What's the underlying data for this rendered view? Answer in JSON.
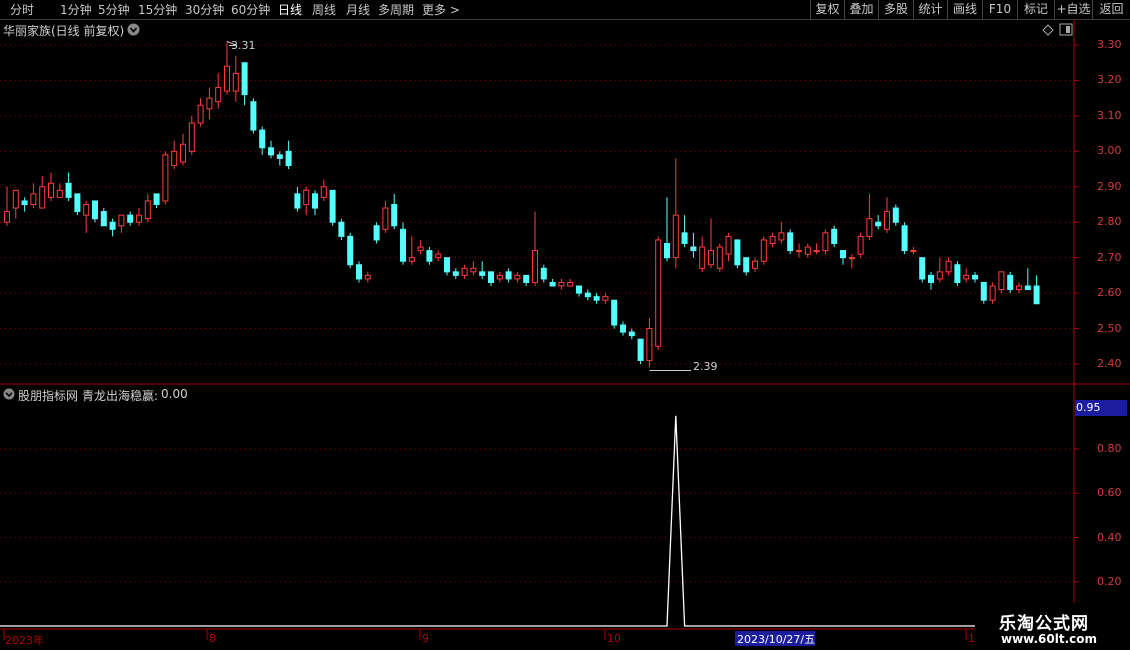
{
  "toolbar": {
    "periods": [
      "分时",
      "1分钟",
      "5分钟",
      "15分钟",
      "30分钟",
      "60分钟",
      "日线",
      "周线",
      "月线",
      "多周期",
      "更多 >"
    ],
    "active": "日线",
    "right_buttons": [
      "复权",
      "叠加",
      "多股",
      "统计",
      "画线",
      "F10",
      "标记",
      "+自选",
      "返回"
    ]
  },
  "main_chart": {
    "title": "华丽家族(日线 前复权)",
    "y_ticks": [
      "3.30",
      "3.20",
      "3.10",
      "3.00",
      "2.90",
      "2.80",
      "2.70",
      "2.60",
      "2.50",
      "2.40"
    ],
    "high_marker": "3.31",
    "low_marker": "2.39"
  },
  "indicator": {
    "label": "股朋指标网",
    "formula_label": "青龙出海稳赢:",
    "formula_value": "0.00",
    "highlight_value": "0.95",
    "y_ticks": [
      "0.80",
      "0.60",
      "0.40",
      "0.20"
    ]
  },
  "xaxis": {
    "labels": [
      "2023年",
      "8",
      "9",
      "10"
    ],
    "cursor_date": "2023/10/27/五",
    "edge_label": "1"
  },
  "watermark": {
    "title": "乐淘公式网",
    "url": "www.60lt.com"
  },
  "colors": {
    "up": "#ff3c3c",
    "down": "#54ffff",
    "grid": "#8b0000",
    "axis": "#b00000"
  },
  "chart_data": {
    "type": "candlestick",
    "x_axis": "trading days, Jul 2023 – Nov 2023",
    "ylim": [
      2.37,
      3.33
    ],
    "candles": [
      {
        "o": 2.8,
        "c": 2.83,
        "h": 2.9,
        "l": 2.79
      },
      {
        "o": 2.84,
        "c": 2.89,
        "h": 2.89,
        "l": 2.81
      },
      {
        "o": 2.86,
        "c": 2.85,
        "h": 2.87,
        "l": 2.83
      },
      {
        "o": 2.85,
        "c": 2.88,
        "h": 2.91,
        "l": 2.84
      },
      {
        "o": 2.84,
        "c": 2.9,
        "h": 2.93,
        "l": 2.84
      },
      {
        "o": 2.87,
        "c": 2.91,
        "h": 2.94,
        "l": 2.86
      },
      {
        "o": 2.87,
        "c": 2.89,
        "h": 2.91,
        "l": 2.87
      },
      {
        "o": 2.91,
        "c": 2.87,
        "h": 2.94,
        "l": 2.86
      },
      {
        "o": 2.88,
        "c": 2.83,
        "h": 2.88,
        "l": 2.82
      },
      {
        "o": 2.82,
        "c": 2.85,
        "h": 2.86,
        "l": 2.77
      },
      {
        "o": 2.86,
        "c": 2.81,
        "h": 2.86,
        "l": 2.8
      },
      {
        "o": 2.83,
        "c": 2.79,
        "h": 2.84,
        "l": 2.79
      },
      {
        "o": 2.8,
        "c": 2.78,
        "h": 2.81,
        "l": 2.76
      },
      {
        "o": 2.79,
        "c": 2.82,
        "h": 2.82,
        "l": 2.77
      },
      {
        "o": 2.82,
        "c": 2.8,
        "h": 2.83,
        "l": 2.79
      },
      {
        "o": 2.8,
        "c": 2.82,
        "h": 2.84,
        "l": 2.79
      },
      {
        "o": 2.81,
        "c": 2.86,
        "h": 2.88,
        "l": 2.8
      },
      {
        "o": 2.88,
        "c": 2.85,
        "h": 2.88,
        "l": 2.84
      },
      {
        "o": 2.86,
        "c": 2.99,
        "h": 3.0,
        "l": 2.85
      },
      {
        "o": 2.96,
        "c": 3.0,
        "h": 3.03,
        "l": 2.95
      },
      {
        "o": 2.97,
        "c": 3.02,
        "h": 3.05,
        "l": 2.96
      },
      {
        "o": 3.0,
        "c": 3.08,
        "h": 3.1,
        "l": 2.99
      },
      {
        "o": 3.08,
        "c": 3.13,
        "h": 3.15,
        "l": 3.07
      },
      {
        "o": 3.12,
        "c": 3.15,
        "h": 3.18,
        "l": 3.09
      },
      {
        "o": 3.14,
        "c": 3.18,
        "h": 3.22,
        "l": 3.12
      },
      {
        "o": 3.17,
        "c": 3.24,
        "h": 3.31,
        "l": 3.16
      },
      {
        "o": 3.17,
        "c": 3.22,
        "h": 3.27,
        "l": 3.14
      },
      {
        "o": 3.25,
        "c": 3.16,
        "h": 3.25,
        "l": 3.13
      },
      {
        "o": 3.14,
        "c": 3.06,
        "h": 3.15,
        "l": 3.05
      },
      {
        "o": 3.06,
        "c": 3.01,
        "h": 3.07,
        "l": 2.99
      },
      {
        "o": 3.01,
        "c": 2.99,
        "h": 3.03,
        "l": 2.98
      },
      {
        "o": 2.99,
        "c": 2.98,
        "h": 3.0,
        "l": 2.96
      },
      {
        "o": 3.0,
        "c": 2.96,
        "h": 3.03,
        "l": 2.95
      },
      {
        "o": 2.88,
        "c": 2.84,
        "h": 2.9,
        "l": 2.83
      },
      {
        "o": 2.85,
        "c": 2.89,
        "h": 2.9,
        "l": 2.82
      },
      {
        "o": 2.88,
        "c": 2.84,
        "h": 2.89,
        "l": 2.82
      },
      {
        "o": 2.87,
        "c": 2.9,
        "h": 2.92,
        "l": 2.86
      },
      {
        "o": 2.89,
        "c": 2.8,
        "h": 2.89,
        "l": 2.79
      },
      {
        "o": 2.8,
        "c": 2.76,
        "h": 2.81,
        "l": 2.75
      },
      {
        "o": 2.76,
        "c": 2.68,
        "h": 2.77,
        "l": 2.67
      },
      {
        "o": 2.68,
        "c": 2.64,
        "h": 2.69,
        "l": 2.63
      },
      {
        "o": 2.64,
        "c": 2.65,
        "h": 2.66,
        "l": 2.63
      },
      {
        "o": 2.79,
        "c": 2.75,
        "h": 2.8,
        "l": 2.74
      },
      {
        "o": 2.78,
        "c": 2.84,
        "h": 2.86,
        "l": 2.77
      },
      {
        "o": 2.85,
        "c": 2.79,
        "h": 2.88,
        "l": 2.78
      },
      {
        "o": 2.78,
        "c": 2.69,
        "h": 2.8,
        "l": 2.68
      },
      {
        "o": 2.69,
        "c": 2.7,
        "h": 2.76,
        "l": 2.68
      },
      {
        "o": 2.72,
        "c": 2.73,
        "h": 2.75,
        "l": 2.71
      },
      {
        "o": 2.72,
        "c": 2.69,
        "h": 2.73,
        "l": 2.68
      },
      {
        "o": 2.7,
        "c": 2.71,
        "h": 2.72,
        "l": 2.69
      },
      {
        "o": 2.7,
        "c": 2.66,
        "h": 2.7,
        "l": 2.65
      },
      {
        "o": 2.66,
        "c": 2.65,
        "h": 2.67,
        "l": 2.64
      },
      {
        "o": 2.65,
        "c": 2.67,
        "h": 2.68,
        "l": 2.64
      },
      {
        "o": 2.66,
        "c": 2.67,
        "h": 2.69,
        "l": 2.65
      },
      {
        "o": 2.66,
        "c": 2.65,
        "h": 2.69,
        "l": 2.64
      },
      {
        "o": 2.66,
        "c": 2.63,
        "h": 2.66,
        "l": 2.62
      },
      {
        "o": 2.64,
        "c": 2.65,
        "h": 2.66,
        "l": 2.63
      },
      {
        "o": 2.66,
        "c": 2.64,
        "h": 2.67,
        "l": 2.63
      },
      {
        "o": 2.64,
        "c": 2.65,
        "h": 2.66,
        "l": 2.63
      },
      {
        "o": 2.65,
        "c": 2.63,
        "h": 2.65,
        "l": 2.62
      },
      {
        "o": 2.63,
        "c": 2.72,
        "h": 2.83,
        "l": 2.62
      },
      {
        "o": 2.67,
        "c": 2.64,
        "h": 2.68,
        "l": 2.63
      },
      {
        "o": 2.63,
        "c": 2.62,
        "h": 2.64,
        "l": 2.62
      },
      {
        "o": 2.62,
        "c": 2.63,
        "h": 2.64,
        "l": 2.61
      },
      {
        "o": 2.62,
        "c": 2.63,
        "h": 2.64,
        "l": 2.62
      },
      {
        "o": 2.62,
        "c": 2.6,
        "h": 2.62,
        "l": 2.59
      },
      {
        "o": 2.6,
        "c": 2.59,
        "h": 2.61,
        "l": 2.58
      },
      {
        "o": 2.59,
        "c": 2.58,
        "h": 2.6,
        "l": 2.57
      },
      {
        "o": 2.58,
        "c": 2.59,
        "h": 2.6,
        "l": 2.57
      },
      {
        "o": 2.58,
        "c": 2.51,
        "h": 2.58,
        "l": 2.5
      },
      {
        "o": 2.51,
        "c": 2.49,
        "h": 2.52,
        "l": 2.48
      },
      {
        "o": 2.49,
        "c": 2.48,
        "h": 2.5,
        "l": 2.47
      },
      {
        "o": 2.47,
        "c": 2.41,
        "h": 2.47,
        "l": 2.4
      },
      {
        "o": 2.41,
        "c": 2.5,
        "h": 2.53,
        "l": 2.39
      },
      {
        "o": 2.45,
        "c": 2.75,
        "h": 2.76,
        "l": 2.44
      },
      {
        "o": 2.74,
        "c": 2.7,
        "h": 2.87,
        "l": 2.69
      },
      {
        "o": 2.7,
        "c": 2.82,
        "h": 2.98,
        "l": 2.67
      },
      {
        "o": 2.77,
        "c": 2.74,
        "h": 2.82,
        "l": 2.73
      },
      {
        "o": 2.73,
        "c": 2.72,
        "h": 2.77,
        "l": 2.7
      },
      {
        "o": 2.67,
        "c": 2.73,
        "h": 2.76,
        "l": 2.66
      },
      {
        "o": 2.68,
        "c": 2.72,
        "h": 2.81,
        "l": 2.67
      },
      {
        "o": 2.67,
        "c": 2.73,
        "h": 2.74,
        "l": 2.66
      },
      {
        "o": 2.71,
        "c": 2.76,
        "h": 2.77,
        "l": 2.69
      },
      {
        "o": 2.75,
        "c": 2.68,
        "h": 2.75,
        "l": 2.67
      },
      {
        "o": 2.7,
        "c": 2.66,
        "h": 2.7,
        "l": 2.65
      },
      {
        "o": 2.67,
        "c": 2.69,
        "h": 2.7,
        "l": 2.66
      },
      {
        "o": 2.69,
        "c": 2.75,
        "h": 2.76,
        "l": 2.68
      },
      {
        "o": 2.74,
        "c": 2.76,
        "h": 2.77,
        "l": 2.73
      },
      {
        "o": 2.75,
        "c": 2.77,
        "h": 2.8,
        "l": 2.74
      },
      {
        "o": 2.77,
        "c": 2.72,
        "h": 2.78,
        "l": 2.71
      },
      {
        "o": 2.72,
        "c": 2.72,
        "h": 2.74,
        "l": 2.7
      },
      {
        "o": 2.71,
        "c": 2.73,
        "h": 2.74,
        "l": 2.7
      },
      {
        "o": 2.72,
        "c": 2.72,
        "h": 2.74,
        "l": 2.71
      },
      {
        "o": 2.72,
        "c": 2.77,
        "h": 2.78,
        "l": 2.71
      },
      {
        "o": 2.78,
        "c": 2.74,
        "h": 2.79,
        "l": 2.73
      },
      {
        "o": 2.72,
        "c": 2.7,
        "h": 2.72,
        "l": 2.68
      },
      {
        "o": 2.7,
        "c": 2.7,
        "h": 2.71,
        "l": 2.67
      },
      {
        "o": 2.71,
        "c": 2.76,
        "h": 2.77,
        "l": 2.7
      },
      {
        "o": 2.76,
        "c": 2.81,
        "h": 2.88,
        "l": 2.75
      },
      {
        "o": 2.8,
        "c": 2.79,
        "h": 2.82,
        "l": 2.78
      },
      {
        "o": 2.78,
        "c": 2.83,
        "h": 2.87,
        "l": 2.77
      },
      {
        "o": 2.84,
        "c": 2.8,
        "h": 2.85,
        "l": 2.79
      },
      {
        "o": 2.79,
        "c": 2.72,
        "h": 2.8,
        "l": 2.71
      },
      {
        "o": 2.72,
        "c": 2.72,
        "h": 2.73,
        "l": 2.71
      },
      {
        "o": 2.7,
        "c": 2.64,
        "h": 2.7,
        "l": 2.63
      },
      {
        "o": 2.65,
        "c": 2.63,
        "h": 2.66,
        "l": 2.61
      },
      {
        "o": 2.64,
        "c": 2.66,
        "h": 2.7,
        "l": 2.63
      },
      {
        "o": 2.66,
        "c": 2.69,
        "h": 2.7,
        "l": 2.65
      },
      {
        "o": 2.68,
        "c": 2.63,
        "h": 2.69,
        "l": 2.62
      },
      {
        "o": 2.64,
        "c": 2.65,
        "h": 2.67,
        "l": 2.63
      },
      {
        "o": 2.65,
        "c": 2.64,
        "h": 2.66,
        "l": 2.63
      },
      {
        "o": 2.63,
        "c": 2.58,
        "h": 2.63,
        "l": 2.57
      },
      {
        "o": 2.58,
        "c": 2.62,
        "h": 2.63,
        "l": 2.57
      },
      {
        "o": 2.61,
        "c": 2.66,
        "h": 2.66,
        "l": 2.6
      },
      {
        "o": 2.65,
        "c": 2.61,
        "h": 2.66,
        "l": 2.6
      },
      {
        "o": 2.61,
        "c": 2.62,
        "h": 2.63,
        "l": 2.6
      },
      {
        "o": 2.62,
        "c": 2.61,
        "h": 2.67,
        "l": 2.61
      },
      {
        "o": 2.62,
        "c": 2.57,
        "h": 2.65,
        "l": 2.57
      }
    ],
    "indicator": {
      "ylim": [
        0,
        0.98
      ],
      "spike_index": 76,
      "spike_value": 0.95
    }
  }
}
